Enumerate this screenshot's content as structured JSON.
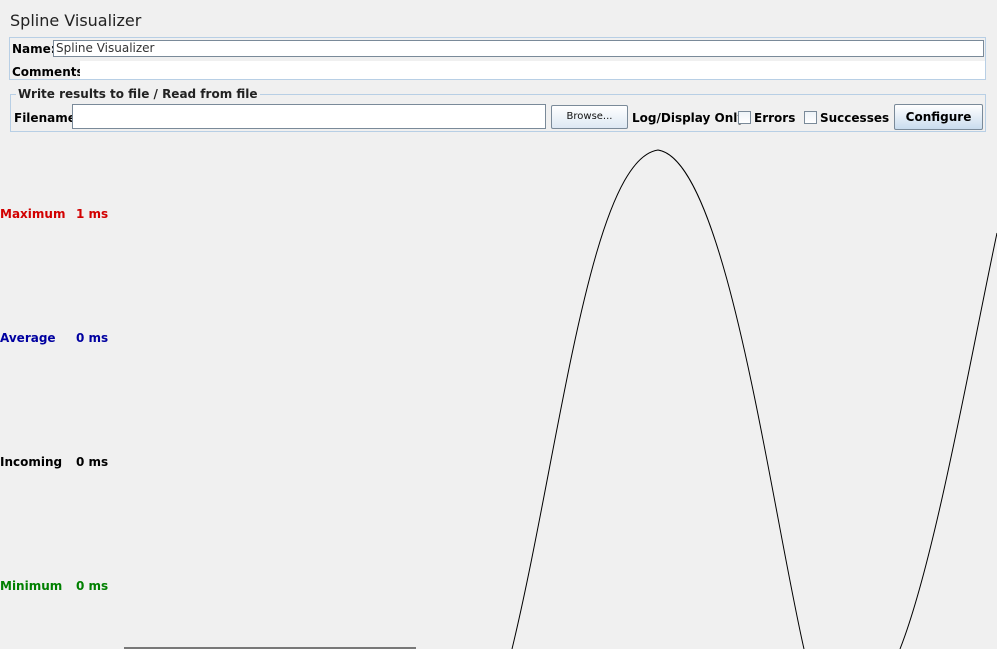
{
  "window": {
    "title": "Spline Visualizer"
  },
  "name_panel": {
    "name_label": "Name:",
    "name_value": "Spline Visualizer",
    "comments_label": "Comments:",
    "comments_value": ""
  },
  "file_panel": {
    "legend": "Write results to file / Read from file",
    "filename_label": "Filename",
    "filename_value": "",
    "browse_label": "Browse...",
    "log_label": "Log/Display Only:",
    "errors_label": "Errors",
    "errors_checked": false,
    "successes_label": "Successes",
    "successes_checked": false,
    "configure_label": "Configure"
  },
  "stats": {
    "maximum": {
      "label": "Maximum",
      "value": "1 ms",
      "color": "#d20000"
    },
    "average": {
      "label": "Average",
      "value": "0 ms",
      "color": "#0000a0"
    },
    "incoming": {
      "label": "Incoming",
      "value": "0 ms",
      "color": "#000000"
    },
    "minimum": {
      "label": "Minimum",
      "value": "0 ms",
      "color": "#008000"
    }
  }
}
